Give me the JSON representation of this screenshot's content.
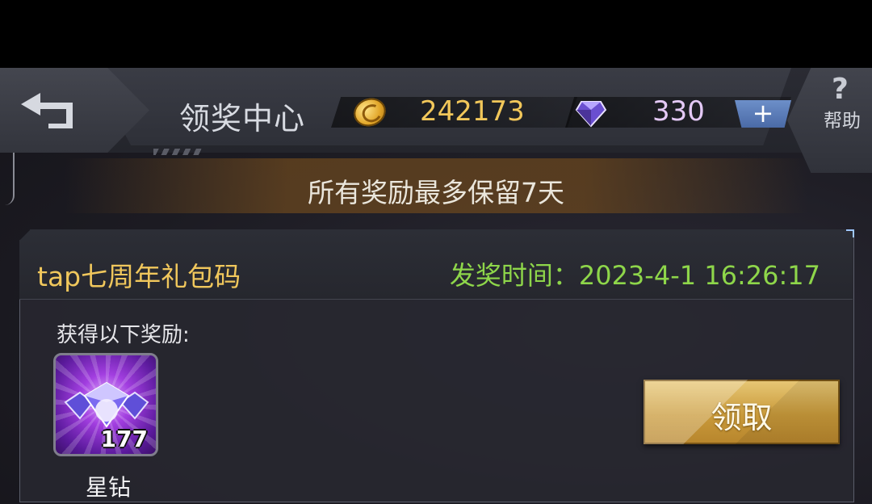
{
  "header": {
    "title": "领奖中心",
    "coins": "242173",
    "gems": "330",
    "plus_label": "+",
    "help_label": "帮助",
    "help_symbol": "?"
  },
  "notice": "所有奖励最多保留7天",
  "reward": {
    "title": "tap七周年礼包码",
    "award_time": "发奖时间：2023-4-1 16:26:17",
    "rewards_label": "获得以下奖励:",
    "item": {
      "name": "星钻",
      "count": "177",
      "icon": "diamond-icon"
    },
    "claim_label": "领取"
  },
  "colors": {
    "accent_gold": "#f0c75c",
    "time_green": "#8ed64a",
    "item_purple": "#a23ee0"
  }
}
